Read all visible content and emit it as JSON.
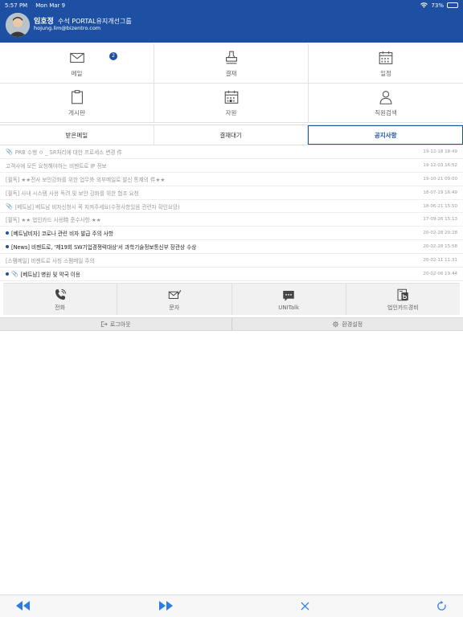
{
  "status": {
    "time": "5:57 PM",
    "date": "Mon Mar 9",
    "battery": "73%",
    "battery_level": 0.73
  },
  "user": {
    "name": "임호정",
    "title": "수석 PORTAL유지개선그룹",
    "email": "hojung.lim@bizentro.com"
  },
  "menu": [
    {
      "label": "메일",
      "icon": "mail-icon",
      "badge": "2"
    },
    {
      "label": "결재",
      "icon": "stamp-icon"
    },
    {
      "label": "일정",
      "icon": "calendar-icon"
    },
    {
      "label": "게시판",
      "icon": "clipboard-icon"
    },
    {
      "label": "자원",
      "icon": "resource-calendar-icon"
    },
    {
      "label": "직원검색",
      "icon": "person-icon"
    }
  ],
  "tabs": {
    "inbox": "받은메일",
    "approval": "결재대기",
    "notice": "공지사항",
    "active": "notice"
  },
  "notices": [
    {
      "title": "PRB 수행 ㅇ _ SR처리에 대한 프로세스 변경 件",
      "date": "19-12-18 18:49",
      "attachment": true,
      "unread": false
    },
    {
      "title": "고객사에 모든 요청해야하는 비젠트로 IP 정보",
      "date": "19-12-03 16:52",
      "attachment": false,
      "unread": false
    },
    {
      "title": "[필독] ★★전사 보안강화를 위한 업무外 외부메일로 발신 통제의 件★★",
      "date": "19-10-21 09:00",
      "attachment": false,
      "unread": false
    },
    {
      "title": "[필독] 사내 시스템 사용 독려 및 보안 강화를 위한 협조 요청",
      "date": "18-07-19 16:49",
      "attachment": false,
      "unread": false
    },
    {
      "title": "[베트남] 베트남 비자신청시 꼭 지켜주세요(수정사항있음 관련자 확인요망)",
      "date": "18-06-21 15:50",
      "attachment": true,
      "unread": false
    },
    {
      "title": "[필독] ★★ 법인카드 사용時 준수사항 ★★",
      "date": "17-09-26 15:13",
      "attachment": false,
      "unread": false
    },
    {
      "title": "[베트남비자] 코로나 관련 비자 발급 주의 사항",
      "date": "20-02-28 20:28",
      "attachment": false,
      "unread": true
    },
    {
      "title": "[News] 비젠트로, '제19회 SW기업경쟁력대상'서 과학기술정보통신부 장관상 수상",
      "date": "20-02-28 15:58",
      "attachment": false,
      "unread": true
    },
    {
      "title": "[스팸메일] 비젠트로 사칭 스팸메일 주의",
      "date": "20-02-11 11:31",
      "attachment": false,
      "unread": false
    },
    {
      "title": "[베트남] 병원 및 약국 이용",
      "date": "20-02-06 19:44",
      "attachment": true,
      "unread": true
    }
  ],
  "quick": [
    {
      "label": "전화",
      "icon": "phone-icon"
    },
    {
      "label": "문자",
      "icon": "sms-icon"
    },
    {
      "label": "UNITalk",
      "icon": "chat-icon"
    },
    {
      "label": "법인카드경비",
      "icon": "card-expense-icon"
    }
  ],
  "bottom": {
    "logout": "로그아웃",
    "settings": "환경설정"
  },
  "colors": {
    "brand": "#1d4fa3",
    "toolbar_accent": "#2a7de1"
  }
}
